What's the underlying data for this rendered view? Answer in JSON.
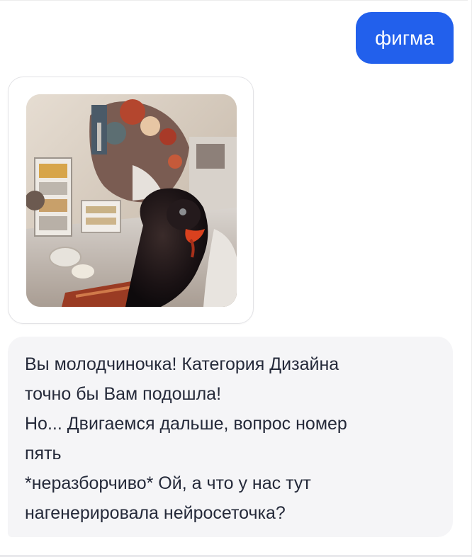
{
  "chat": {
    "outgoing_message": "фигма",
    "image_message": {
      "alt_icon": "generated-image-turkey-icon"
    },
    "incoming_message": {
      "lines": [
        "Вы молодчиночка! Категория Дизайна",
        "точно бы Вам подошла!",
        "Но... Двигаемся дальше, вопрос номер",
        "пять",
        "*неразборчиво* Ой, а что у нас тут",
        "нагенерировала нейросеточка?"
      ]
    }
  },
  "colors": {
    "outgoing_bubble": "#2260ec",
    "incoming_bubble": "#f5f5f7",
    "incoming_text": "#252a3a",
    "outgoing_text": "#ffffff"
  }
}
